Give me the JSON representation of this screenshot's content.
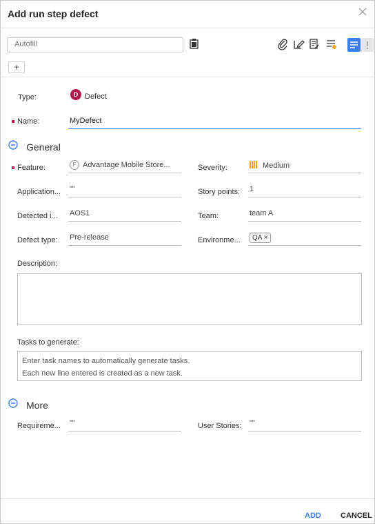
{
  "dialog": {
    "title": "Add run step defect"
  },
  "toolbar": {
    "autofill_placeholder": "Autofill",
    "add_label": "+"
  },
  "form": {
    "type_label": "Type:",
    "type_badge": "D",
    "type_value": "Defect",
    "name_label": "Name:",
    "name_value": "MyDefect",
    "general_title": "General",
    "feature_label": "Feature:",
    "feature_badge": "F",
    "feature_value": "Advantage Mobile Store...",
    "severity_label": "Severity:",
    "severity_value": "Medium",
    "application_label": "Application...",
    "application_value": "\"\"",
    "story_points_label": "Story points:",
    "story_points_value": "1",
    "detected_label": "Detected i...",
    "detected_value": "AOS1",
    "team_label": "Team:",
    "team_value": "team A",
    "defect_type_label": "Defect type:",
    "defect_type_value": "Pre-release",
    "environment_label": "Environme...",
    "environment_chip": "QA ×",
    "description_label": "Description:",
    "tasks_label": "Tasks to generate:",
    "tasks_placeholder_line1": "Enter task names to automatically generate tasks.",
    "tasks_placeholder_line2": "Each new line entered is created as a new task.",
    "more_title": "More",
    "requirements_label": "Requireme...",
    "requirements_value": "\"\"",
    "user_stories_label": "User Stories:",
    "user_stories_value": "\"\""
  },
  "footer": {
    "add_label": "ADD",
    "cancel_label": "CANCEL"
  },
  "colors": {
    "accent": "#3b7ee6",
    "required": "#c2185b",
    "defect_badge": "#b0184e",
    "severity_medium": "#f5a623"
  },
  "icons": [
    "close-icon",
    "template-icon",
    "attachment-icon",
    "signature-icon",
    "document-icon",
    "filter-settings-icon",
    "list-view-icon",
    "info-view-icon",
    "minus-circle-icon"
  ]
}
